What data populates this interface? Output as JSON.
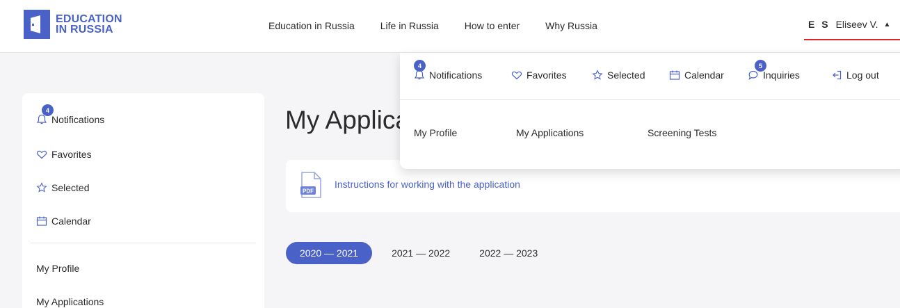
{
  "brand": {
    "line1": "EDUCATION",
    "line2": "IN RUSSIA"
  },
  "topnav": [
    "Education in Russia",
    "Life in Russia",
    "How to enter",
    "Why Russia"
  ],
  "user": {
    "initials": "E S",
    "name": "Eliseev V."
  },
  "sidebar": {
    "items": [
      {
        "label": "Notifications",
        "icon": "bell-icon",
        "badge": "4"
      },
      {
        "label": "Favorites",
        "icon": "heart-icon"
      },
      {
        "label": "Selected",
        "icon": "star-icon"
      },
      {
        "label": "Calendar",
        "icon": "calendar-icon"
      }
    ],
    "links": [
      "My Profile",
      "My Applications"
    ]
  },
  "main": {
    "title": "My Applications",
    "instructions_link": "Instructions for working with the application",
    "pdf_label": "PDF",
    "year_tabs": [
      "2020 — 2021",
      "2021 — 2022",
      "2022 — 2023"
    ],
    "active_year": "2020 — 2021"
  },
  "dropdown": {
    "items": [
      {
        "label": "Notifications",
        "icon": "bell-icon",
        "badge": "4"
      },
      {
        "label": "Favorites",
        "icon": "heart-icon"
      },
      {
        "label": "Selected",
        "icon": "star-icon"
      },
      {
        "label": "Calendar",
        "icon": "calendar-icon"
      },
      {
        "label": "Inquiries",
        "icon": "chat-icon",
        "badge": "5"
      },
      {
        "label": "Log out",
        "icon": "logout-icon"
      }
    ],
    "links": [
      "My Profile",
      "My Applications",
      "Screening Tests"
    ]
  },
  "colors": {
    "accent": "#4a62c8",
    "underline": "#e0222b",
    "background": "#f5f5f7"
  }
}
